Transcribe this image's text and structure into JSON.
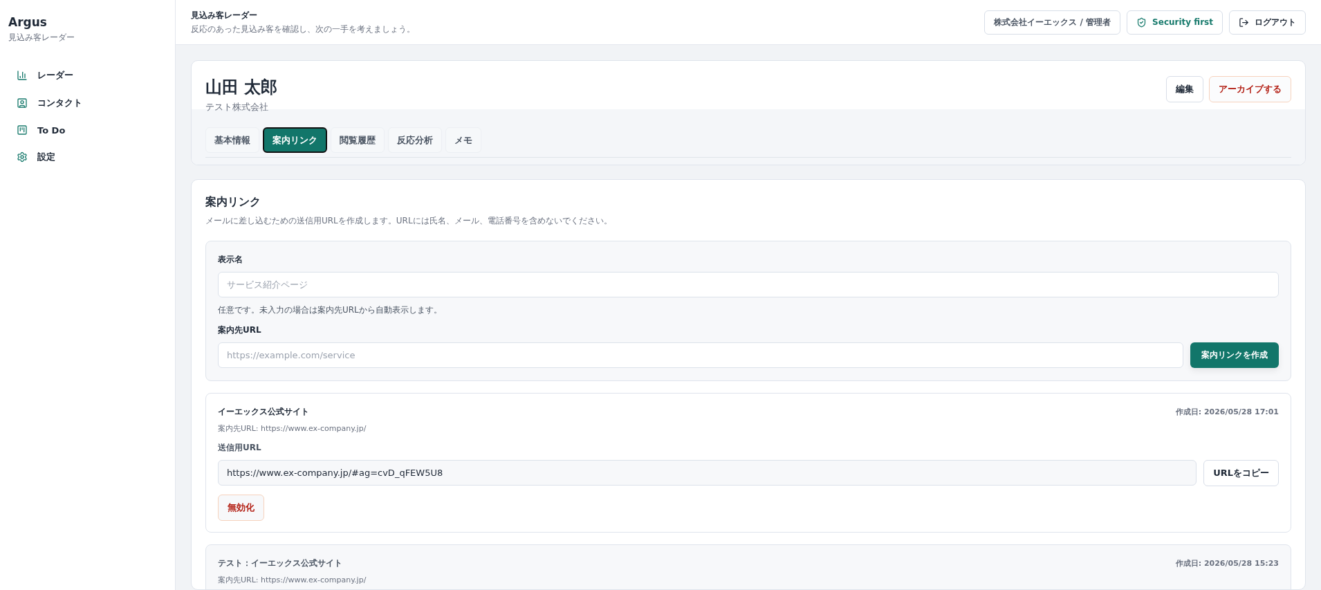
{
  "sidebar": {
    "brand": "Argus",
    "subtitle": "見込み客レーダー",
    "items": [
      {
        "kind": "radar",
        "label": "レーダー",
        "selected": false
      },
      {
        "kind": "contact",
        "label": "コンタクト",
        "selected": false
      },
      {
        "kind": "todo",
        "label": "To Do",
        "selected": false
      },
      {
        "kind": "settings",
        "label": "設定",
        "selected": false
      }
    ]
  },
  "header": {
    "title": "見込み客レーダー",
    "subtitle": "反応のあった見込み客を確認し、次の一手を考えましょう。",
    "account": "株式会社イーエックス / 管理者",
    "security": "Security first",
    "logout": "ログアウト"
  },
  "contact": {
    "name": "山田 太郎",
    "company": "テスト株式会社",
    "edit": "編集",
    "archive": "アーカイブする",
    "tabs": [
      {
        "label": "基本情報",
        "selected": false
      },
      {
        "label": "案内リンク",
        "selected": true
      },
      {
        "label": "閲覧履歴",
        "selected": false
      },
      {
        "label": "反応分析",
        "selected": false
      },
      {
        "label": "メモ",
        "selected": false
      }
    ]
  },
  "section": {
    "title": "案内リンク",
    "description": "メールに差し込むための送信用URLを作成します。URLには氏名、メール、電話番号を含めないでください。",
    "form": {
      "name_label": "表示名",
      "name_placeholder": "サービス紹介ページ",
      "name_hint": "任意です。未入力の場合は案内先URLから自動表示します。",
      "url_label": "案内先URL",
      "url_placeholder": "https://example.com/service",
      "submit": "案内リンクを作成"
    },
    "links": [
      {
        "title": "イーエックス公式サイト",
        "created": "作成日: 2026/05/28 17:01",
        "target": "案内先URL: https://www.ex-company.jp/",
        "active": true,
        "url_label": "送信用URL",
        "url": "https://www.ex-company.jp/#ag=cvD_qFEW5U8",
        "copy": "URLをコピー",
        "revoke": "無効化"
      },
      {
        "title": "テスト：イーエックス公式サイト",
        "created": "作成日: 2026/05/28 15:23",
        "target": "案内先URL: https://www.ex-company.jp/",
        "active": false
      }
    ]
  }
}
